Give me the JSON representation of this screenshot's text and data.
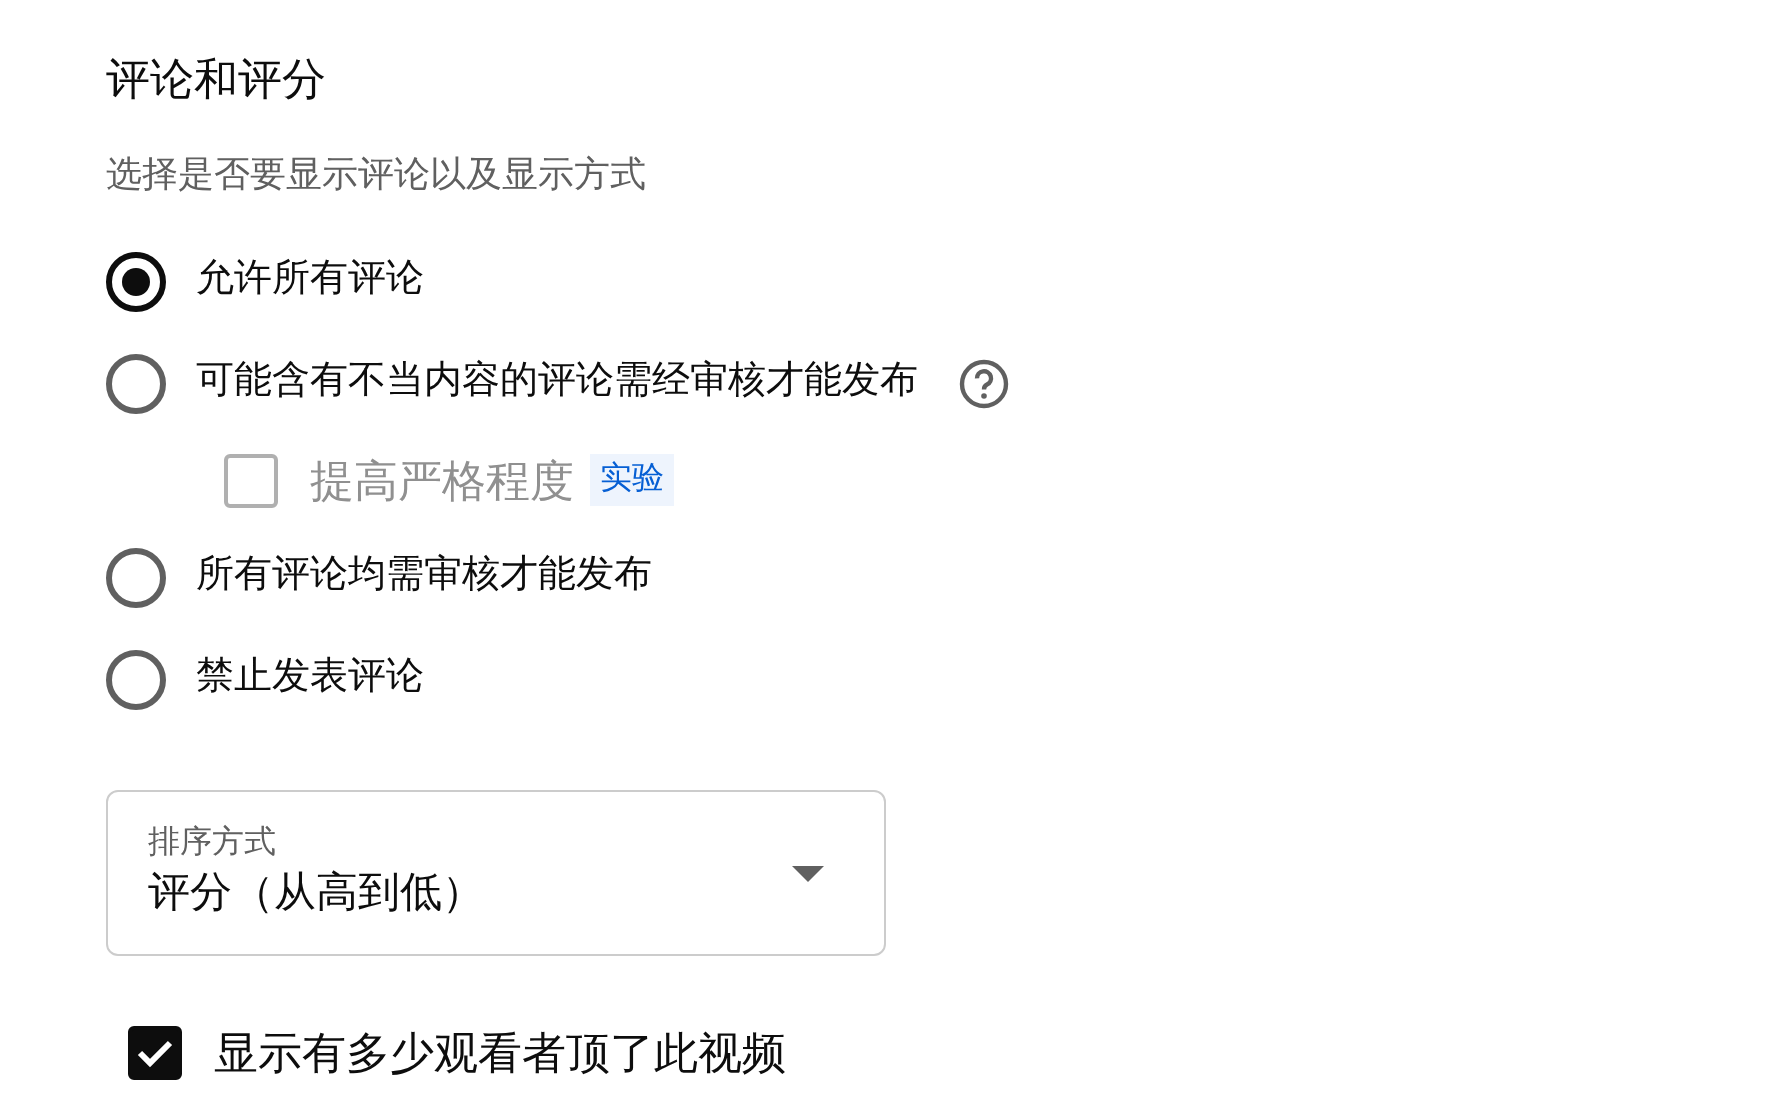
{
  "section": {
    "title": "评论和评分",
    "description": "选择是否要显示评论以及显示方式"
  },
  "options": [
    {
      "label": "允许所有评论",
      "selected": true
    },
    {
      "label": "可能含有不当内容的评论需经审核才能发布",
      "selected": false,
      "help": true,
      "sub_option": {
        "label": "提高严格程度",
        "checked": false,
        "disabled": true,
        "badge": "实验"
      }
    },
    {
      "label": "所有评论均需审核才能发布",
      "selected": false
    },
    {
      "label": "禁止发表评论",
      "selected": false
    }
  ],
  "sort": {
    "label": "排序方式",
    "value": "评分（从高到低）"
  },
  "show_likes": {
    "label": "显示有多少观看者顶了此视频",
    "checked": true
  }
}
